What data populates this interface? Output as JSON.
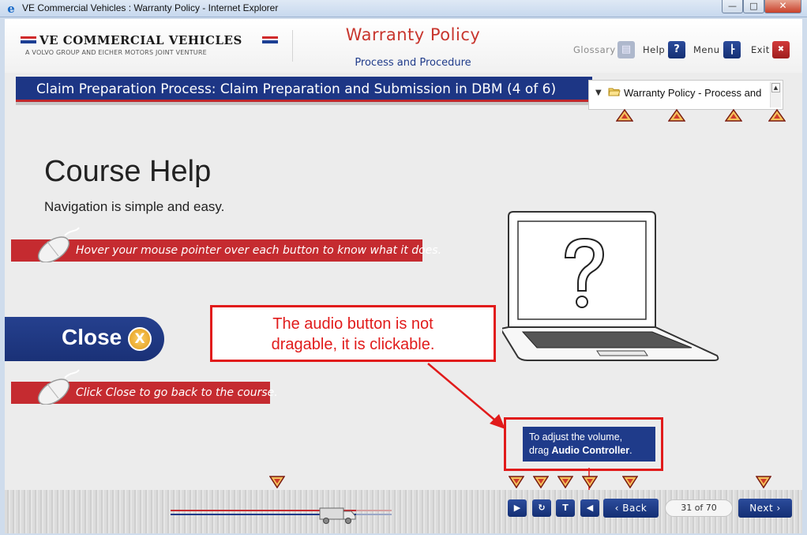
{
  "window": {
    "title": "VE Commercial Vehicles : Warranty Policy - Internet Explorer",
    "minimize_label": "—",
    "maximize_label": "□",
    "close_label": "✕"
  },
  "header": {
    "brand": "VE COMMERCIAL VEHICLES",
    "brand_sub": "A VOLVO GROUP AND EICHER MOTORS JOINT VENTURE",
    "course_title": "Warranty Policy",
    "course_subtitle": "Process and Procedure",
    "nav": {
      "glossary_label": "Glossary",
      "help_label": "Help",
      "help_icon": "?",
      "menu_label": "Menu",
      "exit_label": "Exit",
      "exit_icon": "✖"
    }
  },
  "screen_title": "Claim Preparation Process: Claim Preparation and Submission in DBM (4 of 6)",
  "tree": {
    "item_label": "Warranty Policy - Process and"
  },
  "content": {
    "heading": "Course Help",
    "intro": "Navigation is simple and easy.",
    "hint_hover": "Hover your mouse pointer over each button to know what it does.",
    "close_button_label": "Close",
    "close_icon": "X",
    "hint_close": "Click Close to go back to the course.",
    "callout_line1": "The audio button is not",
    "callout_line2": "dragable, it is clickable.",
    "tooltip_line1": "To adjust the volume,",
    "tooltip_line2_prefix": "drag ",
    "tooltip_line2_bold": "Audio Controller",
    "tooltip_line2_suffix": "."
  },
  "controls": {
    "progress_fraction": 0.84,
    "back_label": "Back",
    "page_counter": "31 of 70",
    "next_label": "Next",
    "text_icon": "T"
  },
  "colors": {
    "navy": "#1d3685",
    "red": "#c52b30",
    "callout_red": "#e11b1b"
  }
}
